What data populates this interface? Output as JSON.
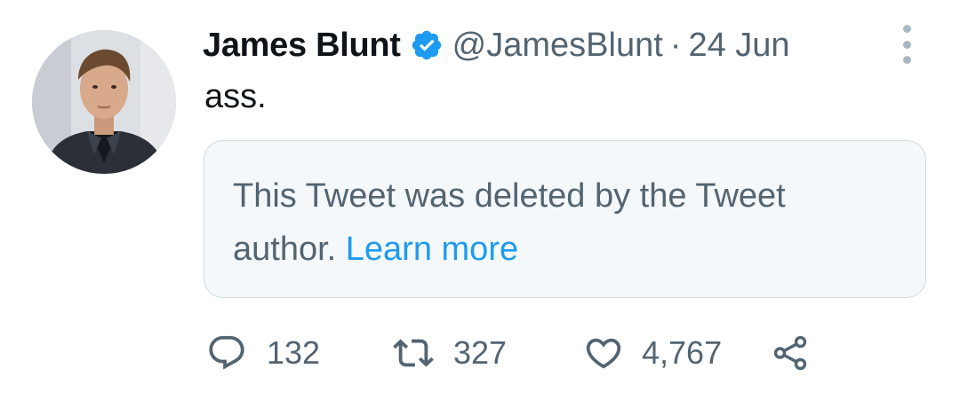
{
  "tweet": {
    "author_name": "James Blunt",
    "handle": "@JamesBlunt",
    "separator": "·",
    "date": "24 Jun",
    "text": "ass.",
    "avatar_icon": "person-photo",
    "verified_icon": "verified-badge-icon",
    "more_icon": "more-vertical-icon"
  },
  "quoted": {
    "message": "This Tweet was deleted by the Tweet author.",
    "link": "Learn more"
  },
  "actions": {
    "reply": {
      "icon": "reply-icon",
      "count": "132"
    },
    "retweet": {
      "icon": "retweet-icon",
      "count": "327"
    },
    "like": {
      "icon": "heart-icon",
      "count": "4,767"
    },
    "share": {
      "icon": "share-icon"
    }
  },
  "colors": {
    "text_primary": "#0f1419",
    "text_secondary": "#536471",
    "link": "#1d9bf0",
    "verified": "#1d9bf0",
    "box_background": "#f5f8fa",
    "box_border": "#cfd9de"
  }
}
